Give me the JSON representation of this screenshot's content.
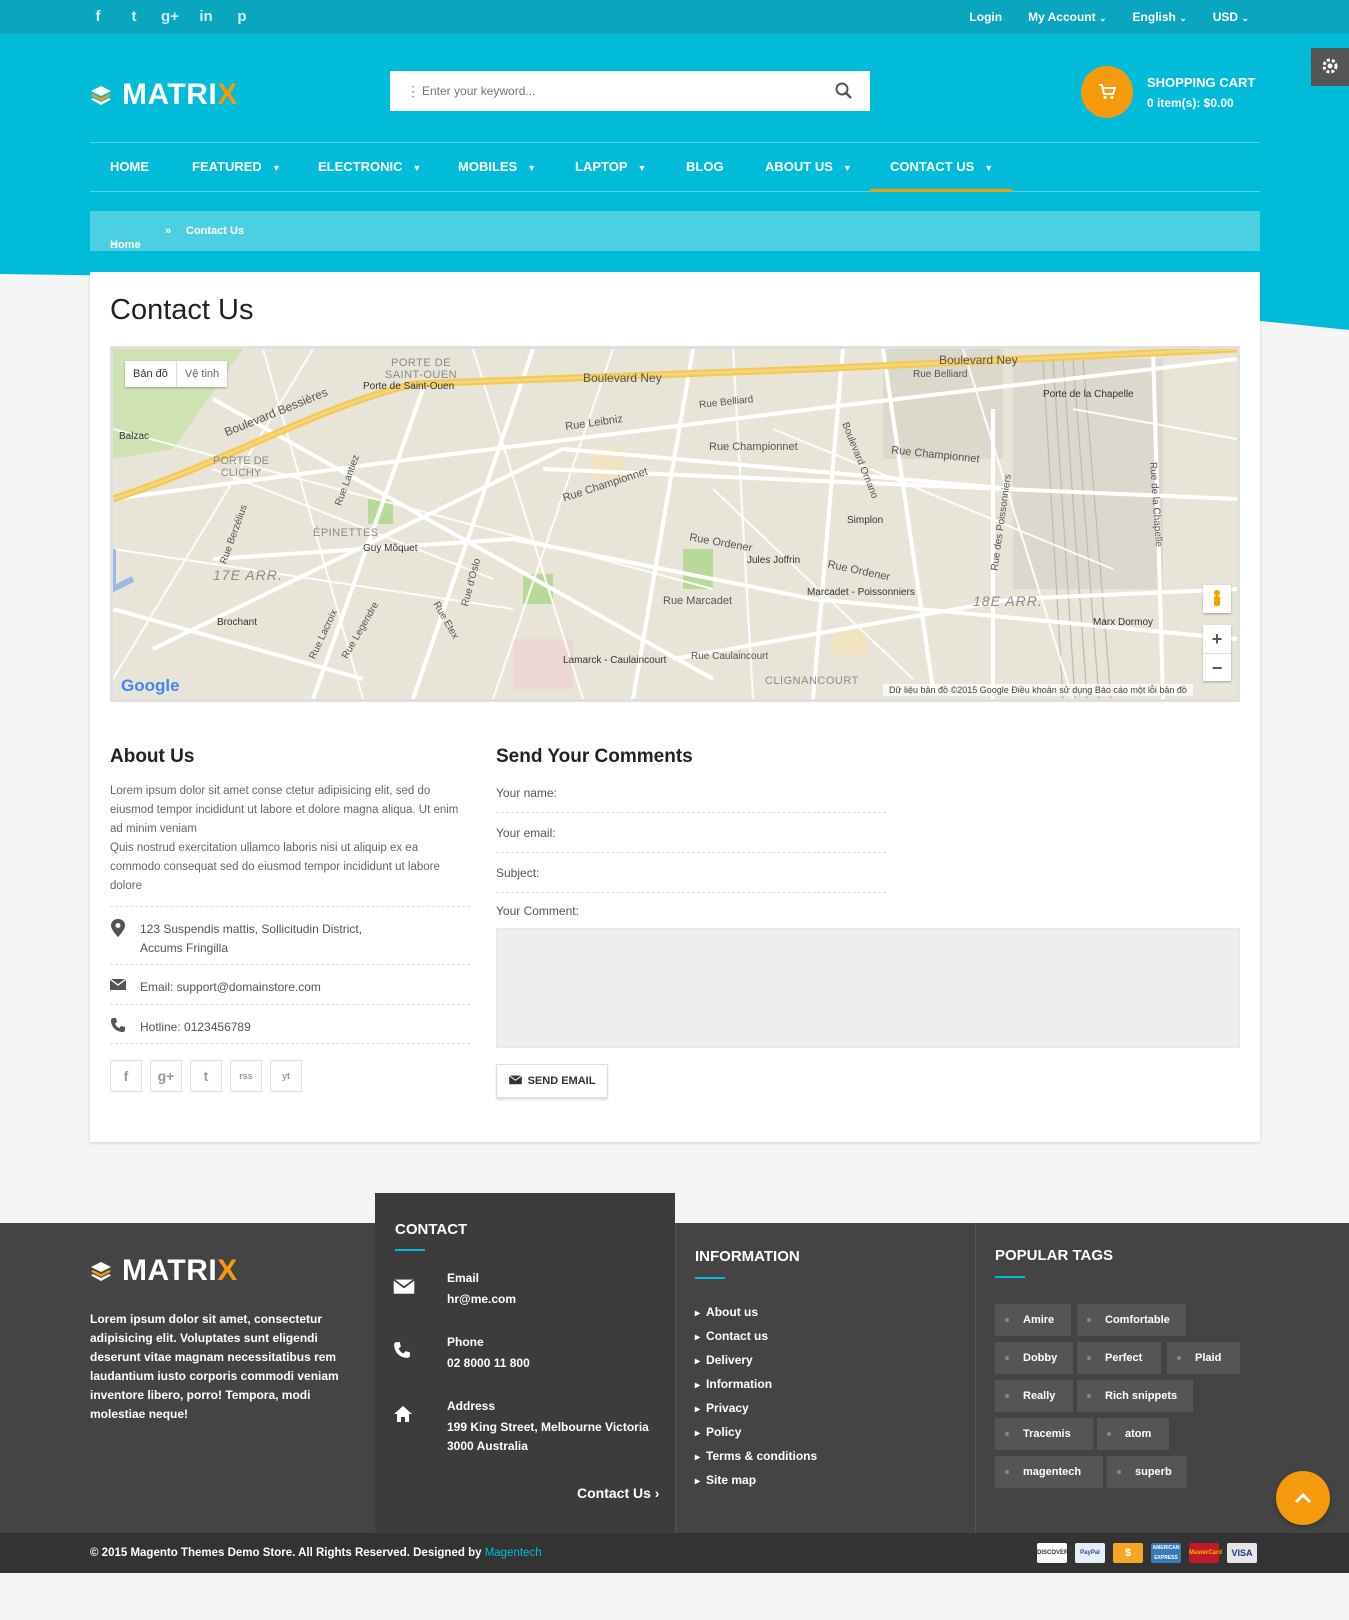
{
  "topbar": {
    "social": [
      "f",
      "t",
      "g+",
      "in",
      "p"
    ],
    "links": [
      {
        "label": "Login"
      },
      {
        "label": "My Account",
        "dropdown": true
      },
      {
        "label": "English",
        "dropdown": true
      },
      {
        "label": "USD",
        "dropdown": true
      }
    ]
  },
  "logo": {
    "text_main": "MATRI",
    "text_accent": "X"
  },
  "search": {
    "placeholder": "Enter your keyword..."
  },
  "cart": {
    "title": "SHOPPING CART",
    "summary": "0 item(s): $0.00"
  },
  "nav": [
    {
      "label": "HOME",
      "dropdown": false
    },
    {
      "label": "FEATURED",
      "dropdown": true
    },
    {
      "label": "ELECTRONIC",
      "dropdown": true
    },
    {
      "label": "MOBILES",
      "dropdown": true
    },
    {
      "label": "LAPTOP",
      "dropdown": true
    },
    {
      "label": "BLOG",
      "dropdown": false
    },
    {
      "label": "ABOUT US",
      "dropdown": true
    },
    {
      "label": "CONTACT US",
      "dropdown": true,
      "active": true
    }
  ],
  "breadcrumb": {
    "home": "Home",
    "current": "Contact Us"
  },
  "page": {
    "title": "Contact Us"
  },
  "map": {
    "type_map": "Bản đồ",
    "type_satellite": "Vệ tinh",
    "logo": "Google",
    "attribution": "Dữ liệu bản đồ ©2015 Google    Điều khoản sử dụng    Báo cáo một lỗi bản đồ",
    "labels": [
      "Boulevard Ney",
      "Boulevard Bessières",
      "Porte de Saint-Ouen",
      "PORTE DE SAINT-OUEN",
      "Rue Belliard",
      "Rue Leibniz",
      "Rue Championnet",
      "Porte de la Chapelle",
      "Balzac",
      "PORTE DE CLICHY",
      "Rue Lantiez",
      "ÉPINETTES",
      "Guy Môquet",
      "Rue Berzélius",
      "17E ARR.",
      "Brochant",
      "Rue Lacroix",
      "Rue Legendre",
      "Rue d'Oslo",
      "Rue Etex",
      "Rue Ordener",
      "Jules Joffrin",
      "Simplon",
      "Boulevard Ornano",
      "Marcadet - Poissonniers",
      "Rue Marcadet",
      "Lamarck - Caulaincourt",
      "Rue Caulaincourt",
      "18E ARR.",
      "Rue des Poissonniers",
      "Marx Dormoy",
      "Rue de la Chapelle",
      "CLIGNANCOURT"
    ]
  },
  "about": {
    "title": "About Us",
    "text1": "Lorem ipsum dolor sit amet conse ctetur adipisicing elit, sed do eiusmod tempor incididunt ut labore et dolore magna aliqua. Ut enim ad minim veniam",
    "text2": "Quis nostrud exercitation ullamco laboris nisi ut aliquip ex ea commodo consequat sed do eiusmod tempor incididunt ut labore dolore",
    "address_line1": "123 Suspendis mattis, Sollicitudin District,",
    "address_line2": "Accums Fringilla",
    "email": "Email: support@domainstore.com",
    "hotline": "Hotline: 0123456789",
    "social": [
      "f",
      "g+",
      "t",
      "rss",
      "yt"
    ]
  },
  "form": {
    "title": "Send Your Comments",
    "name_label": "Your name:",
    "email_label": "Your email:",
    "subject_label": "Subject:",
    "comment_label": "Your Comment:",
    "send_label": "SEND EMAIL"
  },
  "footer": {
    "about_text": "Lorem ipsum dolor sit amet, consectetur adipisicing elit. Voluptates sunt eligendi deserunt vitae magnam necessitatibus rem laudantium iusto corporis commodi veniam inventore libero, porro! Tempora, modi molestiae neque!",
    "contact": {
      "title": "CONTACT",
      "email_label": "Email",
      "email_value": "hr@me.com",
      "phone_label": "Phone",
      "phone_value": "02 8000 11 800",
      "address_label": "Address",
      "address_value": "199 King Street, Melbourne Victoria 3000 Australia",
      "more_link": "Contact Us"
    },
    "information": {
      "title": "INFORMATION",
      "links": [
        "About us",
        "Contact us",
        "Delivery",
        "Information",
        "Privacy",
        "Policy",
        "Terms & conditions",
        "Site map"
      ]
    },
    "tags": {
      "title": "POPULAR TAGS",
      "items": [
        "Amire",
        "Comfortable",
        "Dobby",
        "Perfect",
        "Plaid",
        "Really",
        "Rich snippets",
        "Tracemis",
        "atom",
        "magentech",
        "superb"
      ]
    },
    "copyright": "© 2015 Magento Themes Demo Store. All Rights Reserved. Designed by ",
    "designer": "Magentech",
    "payments": [
      "DISCOVER",
      "PayPal",
      "$",
      "AMERICAN EXPRESS",
      "MasterCard",
      "VISA"
    ]
  },
  "colors": {
    "brand": "#00bcd9",
    "topbar": "#0aa6bf",
    "accent": "#f59a0c",
    "footer": "#444444"
  }
}
